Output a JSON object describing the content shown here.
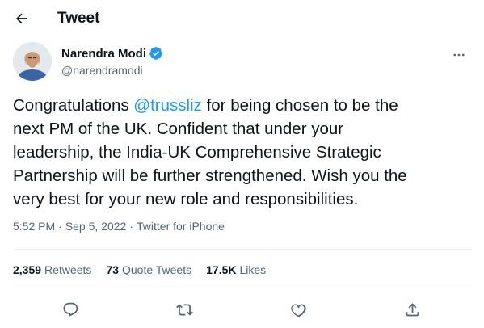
{
  "header": {
    "title": "Tweet",
    "back_icon": "arrow-left-icon"
  },
  "author": {
    "name": "Narendra Modi",
    "handle": "@narendramodi",
    "verified": true,
    "verified_color": "#1d9bf0",
    "more_icon": "more-horizontal-icon"
  },
  "tweet": {
    "lines": [
      [
        "Congratulations ",
        "@trussliz",
        " for being chosen to be the"
      ],
      [
        "next PM of the UK. Confident that under your"
      ],
      [
        "leadership, the India-UK Comprehensive Strategic"
      ],
      [
        "Partnership will be further strengthened. Wish you the"
      ],
      [
        "very best for your new role and responsibilities."
      ]
    ],
    "mention": "@trussliz",
    "mention_color": "#1d9bf0"
  },
  "meta": {
    "time": "5:52 PM",
    "separator": "·",
    "date": "Sep 5, 2022",
    "source": "Twitter for iPhone"
  },
  "stats": {
    "retweets": {
      "value": "2,359",
      "label": "Retweets"
    },
    "quote_tweets": {
      "value": "73",
      "label": "Quote Tweets"
    },
    "likes": {
      "value": "17.5K",
      "label": "Likes"
    }
  },
  "actions": [
    {
      "name": "reply",
      "icon": "reply-icon"
    },
    {
      "name": "retweet",
      "icon": "retweet-icon"
    },
    {
      "name": "like",
      "icon": "heart-icon"
    },
    {
      "name": "share",
      "icon": "share-icon"
    }
  ],
  "colors": {
    "text": "#0f1419",
    "secondary": "#536471",
    "accent": "#1d9bf0",
    "divider": "#eff3f4"
  }
}
